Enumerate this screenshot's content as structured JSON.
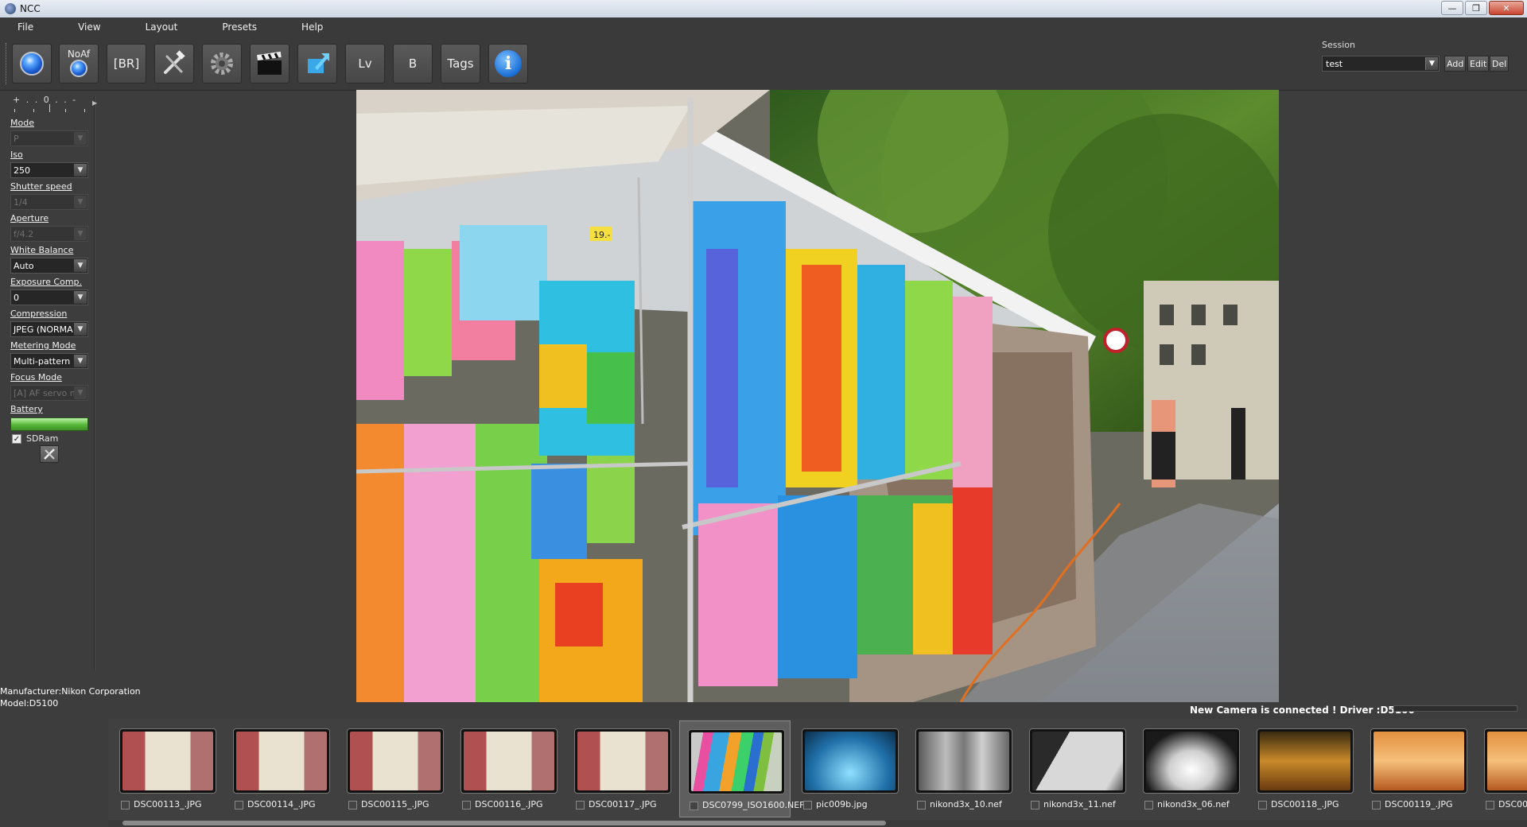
{
  "window": {
    "title": "NCC",
    "controls": [
      "—",
      "❐",
      "✕"
    ]
  },
  "menu": [
    "File",
    "View",
    "Layout",
    "Presets",
    "Help"
  ],
  "toolbar": {
    "buttons": [
      {
        "name": "capture",
        "label": ""
      },
      {
        "name": "noaf",
        "label": "NoAf"
      },
      {
        "name": "bracket",
        "label": "[BR]"
      },
      {
        "name": "tools",
        "label": ""
      },
      {
        "name": "settings",
        "label": ""
      },
      {
        "name": "movie",
        "label": ""
      },
      {
        "name": "browse",
        "label": ""
      },
      {
        "name": "liveview",
        "label": "Lv"
      },
      {
        "name": "bulb",
        "label": "B"
      },
      {
        "name": "tags",
        "label": "Tags"
      },
      {
        "name": "info",
        "label": "i"
      }
    ]
  },
  "session": {
    "label": "Session",
    "value": "test",
    "add": "Add",
    "edit": "Edit",
    "del": "Del"
  },
  "exposure_ruler": {
    "text": "+ . . 0 . . -"
  },
  "controls": [
    {
      "label": "Mode",
      "value": "P",
      "enabled": false
    },
    {
      "label": "Iso",
      "value": "250",
      "enabled": true
    },
    {
      "label": "Shutter speed",
      "value": "1/4",
      "enabled": false
    },
    {
      "label": "Aperture",
      "value": "f/4.2",
      "enabled": false
    },
    {
      "label": "White Balance",
      "value": "Auto",
      "enabled": true
    },
    {
      "label": "Exposure Comp.",
      "value": "0",
      "enabled": true
    },
    {
      "label": "Compression",
      "value": "JPEG (NORMA",
      "enabled": true
    },
    {
      "label": "Metering Mode",
      "value": "Multi-pattern",
      "enabled": true
    },
    {
      "label": "Focus Mode",
      "value": "[A] AF servo m",
      "enabled": false
    }
  ],
  "battery": {
    "label": "Battery",
    "level": 1.0
  },
  "sdram": {
    "label": "SDRam",
    "checked": true
  },
  "camera_info": {
    "manufacturer": "Manufacturer:Nikon Corporation",
    "model": "Model:D5100"
  },
  "status": {
    "text": "New Camera is connected ! Driver :D5100",
    "progress": 0
  },
  "thumbnails": [
    {
      "name": "DSC00113_.JPG",
      "style": "clock",
      "selected": false
    },
    {
      "name": "DSC00114_.JPG",
      "style": "clock",
      "selected": false
    },
    {
      "name": "DSC00115_.JPG",
      "style": "clock",
      "selected": false
    },
    {
      "name": "DSC00116_.JPG",
      "style": "clock",
      "selected": false
    },
    {
      "name": "DSC00117_.JPG",
      "style": "clock",
      "selected": false
    },
    {
      "name": "DSC0799_ISO1600.NEF",
      "style": "market",
      "selected": true
    },
    {
      "name": "pic009b.jpg",
      "style": "water",
      "selected": false
    },
    {
      "name": "nikond3x_10.nef",
      "style": "grey1",
      "selected": false
    },
    {
      "name": "nikond3x_11.nef",
      "style": "grey2",
      "selected": false
    },
    {
      "name": "nikond3x_06.nef",
      "style": "fountain",
      "selected": false
    },
    {
      "name": "DSC00118_.JPG",
      "style": "room",
      "selected": false
    },
    {
      "name": "DSC00119_.JPG",
      "style": "orange",
      "selected": false
    },
    {
      "name": "DSC00",
      "style": "orange",
      "selected": false
    }
  ],
  "preview": {
    "description_icon": "photo-preview",
    "price_tag": "19.-"
  },
  "colors": {
    "background": "#3d3d3d",
    "accent": "#1c5fd4",
    "battery": "#56b838"
  }
}
